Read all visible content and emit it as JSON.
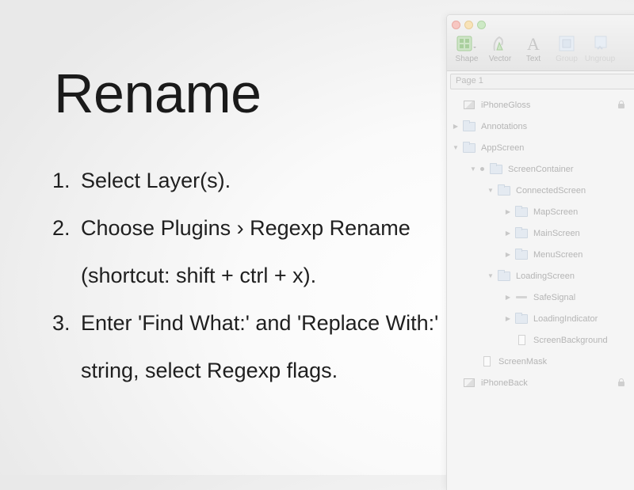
{
  "slide": {
    "title": "Rename",
    "steps": [
      {
        "num": "1.",
        "lines": [
          "Select Layer(s)."
        ]
      },
      {
        "num": "2.",
        "lines": [
          "Choose Plugins › Regexp Rename",
          "(shortcut: shift + ctrl + x)."
        ]
      },
      {
        "num": "3.",
        "lines": [
          "Enter 'Find What:' and 'Replace With:'",
          "string, select Regexp flags."
        ]
      }
    ]
  },
  "window": {
    "toolbar": [
      {
        "label": "Shape",
        "icon": "shape-icon",
        "enabled": true
      },
      {
        "label": "Vector",
        "icon": "vector-pen-icon",
        "enabled": true
      },
      {
        "label": "Text",
        "icon": "text-icon",
        "enabled": true
      },
      {
        "label": "Group",
        "icon": "group-icon",
        "enabled": false
      },
      {
        "label": "Ungroup",
        "icon": "ungroup-icon",
        "enabled": false
      }
    ],
    "page_selector": "Page 1",
    "layers": [
      {
        "name": "iPhoneGloss",
        "kind": "bitmap",
        "depth": 0,
        "arrow": "none",
        "locked": true
      },
      {
        "name": "Annotations",
        "kind": "folder",
        "depth": 0,
        "arrow": "collapsed",
        "locked": false
      },
      {
        "name": "AppScreen",
        "kind": "folder",
        "depth": 0,
        "arrow": "expanded",
        "locked": false
      },
      {
        "name": "ScreenContainer",
        "kind": "folder",
        "depth": 1,
        "arrow": "expanded",
        "bullet": true,
        "locked": false
      },
      {
        "name": "ConnectedScreen",
        "kind": "folder",
        "depth": 2,
        "arrow": "expanded",
        "locked": false
      },
      {
        "name": "MapScreen",
        "kind": "folder",
        "depth": 3,
        "arrow": "collapsed",
        "locked": false
      },
      {
        "name": "MainScreen",
        "kind": "folder",
        "depth": 3,
        "arrow": "collapsed",
        "locked": false
      },
      {
        "name": "MenuScreen",
        "kind": "folder",
        "depth": 3,
        "arrow": "collapsed",
        "locked": false
      },
      {
        "name": "LoadingScreen",
        "kind": "folder",
        "depth": 2,
        "arrow": "expanded",
        "locked": false
      },
      {
        "name": "SafeSignal",
        "kind": "line",
        "depth": 3,
        "arrow": "collapsed",
        "locked": false
      },
      {
        "name": "LoadingIndicator",
        "kind": "folder",
        "depth": 3,
        "arrow": "collapsed",
        "locked": false
      },
      {
        "name": "ScreenBackground",
        "kind": "rect",
        "depth": 3,
        "arrow": "none",
        "locked": false
      },
      {
        "name": "ScreenMask",
        "kind": "rect",
        "depth": 1,
        "arrow": "none",
        "locked": false
      },
      {
        "name": "iPhoneBack",
        "kind": "bitmap",
        "depth": 0,
        "arrow": "none",
        "locked": true
      }
    ]
  }
}
